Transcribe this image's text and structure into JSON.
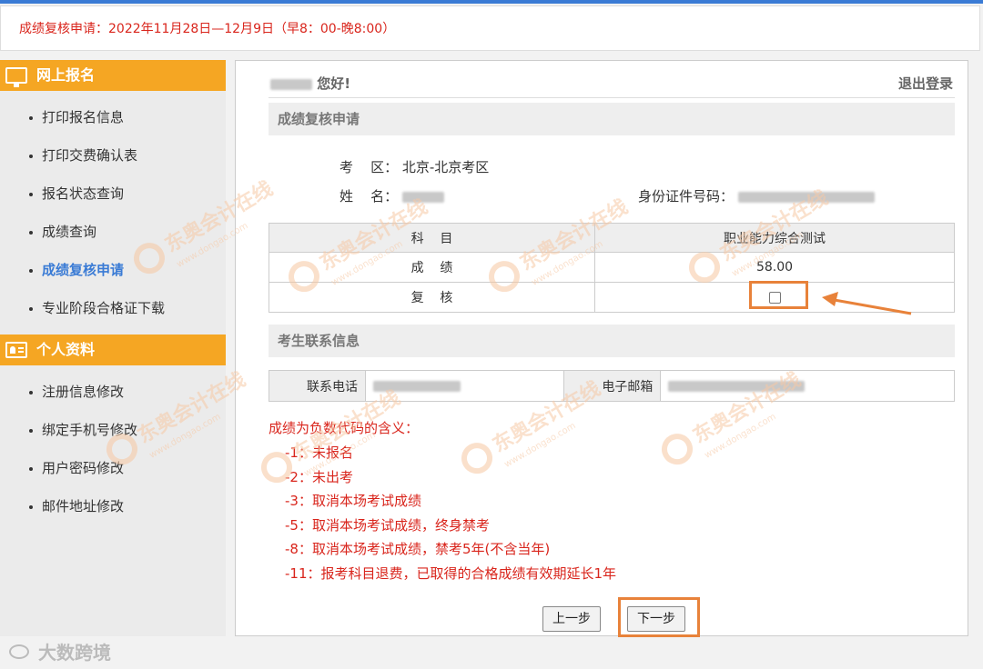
{
  "notice": "成绩复核申请：2022年11月28日—12月9日（早8：00-晚8:00）",
  "sidebar": {
    "section1_title": "网上报名",
    "section1_items": [
      "打印报名信息",
      "打印交费确认表",
      "报名状态查询",
      "成绩查询",
      "成绩复核申请",
      "专业阶段合格证下载"
    ],
    "section2_title": "个人资料",
    "section2_items": [
      "注册信息修改",
      "绑定手机号修改",
      "用户密码修改",
      "邮件地址修改"
    ],
    "active_item": "成绩复核申请"
  },
  "header": {
    "greeting": "您好!",
    "logout": "退出登录"
  },
  "review": {
    "section_title": "成绩复核申请",
    "area_label": "考    区：",
    "area_value": "北京-北京考区",
    "name_label": "姓    名：",
    "id_label": "身份证件号码："
  },
  "table": {
    "subject_label": "科    目",
    "subject_value": "职业能力综合测试",
    "score_label": "成    绩",
    "score_value": "58.00",
    "review_label": "复    核",
    "review_checked": false
  },
  "contact": {
    "section_title": "考生联系信息",
    "phone_label": "联系电话",
    "email_label": "电子邮箱"
  },
  "codes": {
    "title": "成绩为负数代码的含义：",
    "items": [
      "-1：未报名",
      "-2：未出考",
      "-3：取消本场考试成绩",
      "-5：取消本场考试成绩，终身禁考",
      "-8：取消本场考试成绩，禁考5年(不含当年)",
      "-11：报考科目退费，已取得的合格成绩有效期延长1年"
    ]
  },
  "buttons": {
    "prev": "上一步",
    "next": "下一步"
  },
  "watermark": {
    "text": "东奥会计在线",
    "url": "www.dongao.com",
    "footer": "大数跨境"
  },
  "colors": {
    "accent_orange": "#f5a623",
    "highlight": "#e8823a",
    "link_blue": "#3a7bd5",
    "red_text": "#d9251c"
  }
}
